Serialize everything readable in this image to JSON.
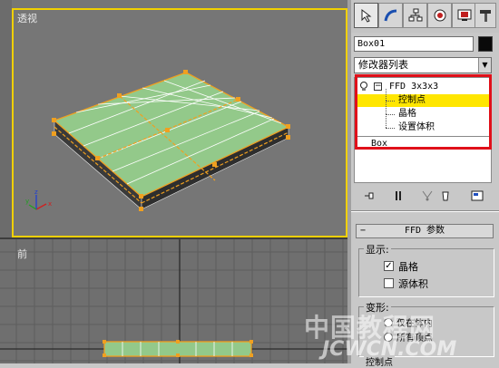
{
  "viewports": {
    "perspective_label": "透视",
    "front_label": "前"
  },
  "panel": {
    "tabs": [
      {
        "icon": "select-arrow-icon",
        "active": true
      },
      {
        "icon": "modify-curve-icon",
        "active": false
      },
      {
        "icon": "hierarchy-icon",
        "active": false
      },
      {
        "icon": "motion-wheel-icon",
        "active": false
      },
      {
        "icon": "display-monitor-icon",
        "active": false
      },
      {
        "icon": "utilities-hammer-icon",
        "active": false
      }
    ],
    "object_name": "Box01",
    "object_color": "#000000",
    "modifier_list_label": "修改器列表",
    "stack": {
      "ffd_label": "FFD 3x3x3",
      "sub_items": [
        "控制点",
        "晶格",
        "设置体积"
      ],
      "selected_sub_index": 0,
      "base_label": "Box"
    },
    "rollout": {
      "title": "FFD 参数",
      "display_group": "显示:",
      "lattice_label": "晶格",
      "lattice_checked": true,
      "source_volume_label": "源体积",
      "source_volume_checked": false,
      "deform_group": "变形:",
      "deform_option1": "仅在体内",
      "deform_option2": "所有顶点",
      "control_points_group": "控制点"
    }
  },
  "watermark": {
    "line1": "中国教程网",
    "line2": "JCWCN.COM"
  },
  "colors": {
    "viewport_active_border": "#f0d000",
    "stack_selection": "#ffe600",
    "highlight_frame": "#e0101a",
    "mesh_face": "#93c98a",
    "lattice": "#f0a020"
  }
}
